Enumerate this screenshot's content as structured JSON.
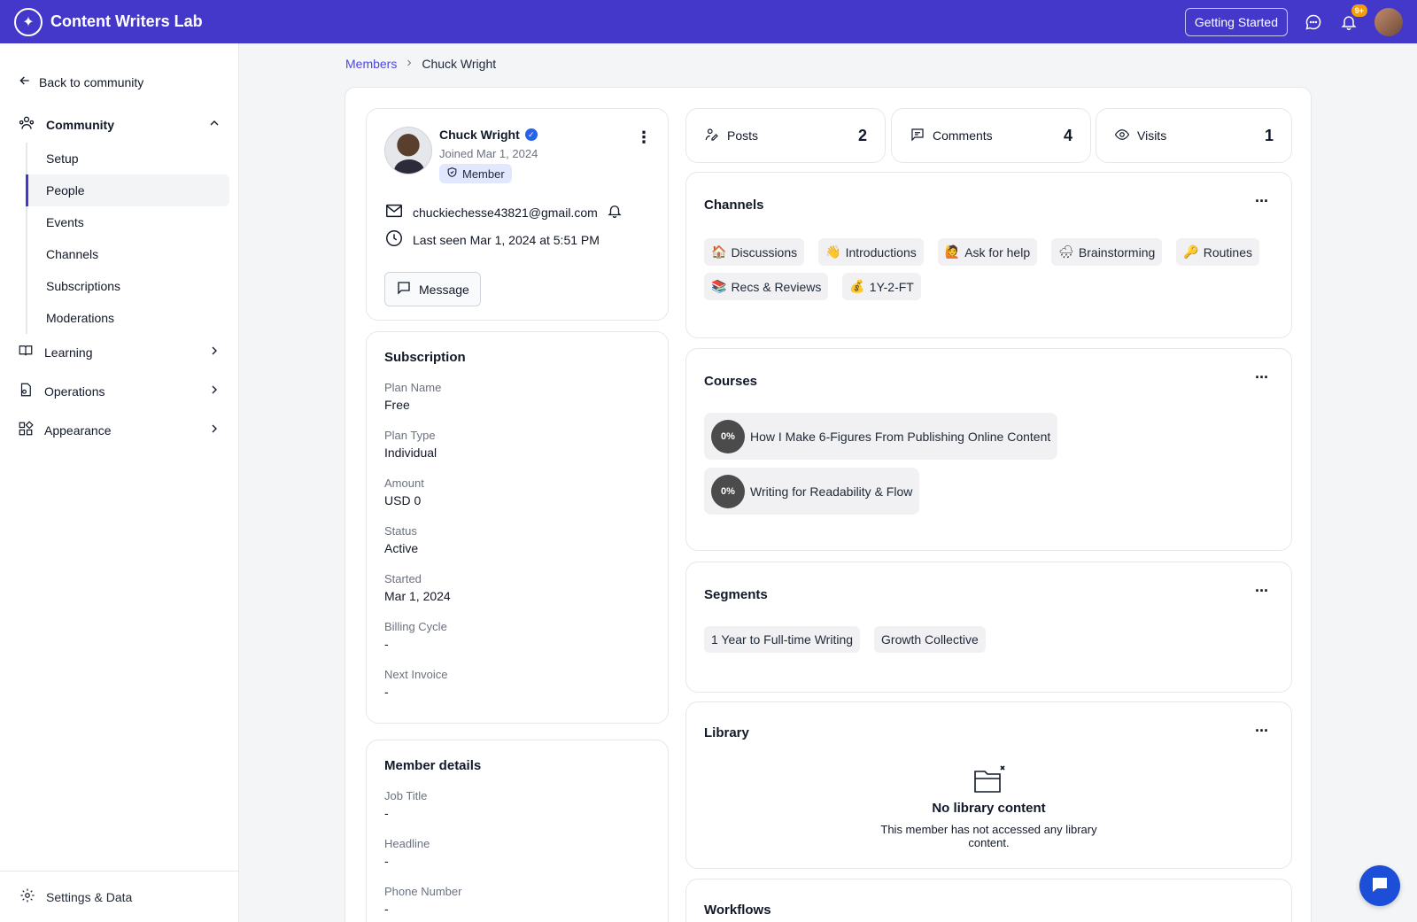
{
  "app": {
    "name": "Content Writers Lab",
    "getting_started": "Getting Started",
    "notif_count": "9+",
    "accent": "#4338ca"
  },
  "sidebar": {
    "back": "Back to community",
    "community": "Community",
    "sub_items": [
      "Setup",
      "People",
      "Events",
      "Channels",
      "Subscriptions",
      "Moderations"
    ],
    "learning": "Learning",
    "operations": "Operations",
    "appearance": "Appearance",
    "footer": "Settings & Data"
  },
  "breadcrumb": {
    "parent": "Members",
    "current": "Chuck Wright"
  },
  "profile": {
    "name": "Chuck Wright",
    "joined": "Joined Mar 1, 2024",
    "role": "Member",
    "email": "chuckiechesse43821@gmail.com",
    "last_seen": "Last seen Mar 1, 2024 at 5:51 PM",
    "message_label": "Message"
  },
  "subscription": {
    "title": "Subscription",
    "fields": [
      {
        "label": "Plan Name",
        "value": "Free"
      },
      {
        "label": "Plan Type",
        "value": "Individual"
      },
      {
        "label": "Amount",
        "value": "USD 0"
      },
      {
        "label": "Status",
        "value": "Active"
      },
      {
        "label": "Started",
        "value": "Mar 1, 2024"
      },
      {
        "label": "Billing Cycle",
        "value": "-"
      },
      {
        "label": "Next Invoice",
        "value": "-"
      }
    ]
  },
  "member_details": {
    "title": "Member details",
    "fields": [
      {
        "label": "Job Title",
        "value": "-"
      },
      {
        "label": "Headline",
        "value": "-"
      },
      {
        "label": "Phone Number",
        "value": "-"
      }
    ]
  },
  "stats": {
    "posts_label": "Posts",
    "posts": "2",
    "comments_label": "Comments",
    "comments": "4",
    "visits_label": "Visits",
    "visits": "1"
  },
  "channels": {
    "title": "Channels",
    "items": [
      {
        "emoji": "🏠",
        "label": "Discussions"
      },
      {
        "emoji": "👋",
        "label": "Introductions"
      },
      {
        "emoji": "🙋",
        "label": "Ask for help"
      },
      {
        "emoji": "🌧",
        "label": "Brainstorming"
      },
      {
        "emoji": "🔑",
        "label": "Routines"
      },
      {
        "emoji": "📚",
        "label": "Recs & Reviews"
      },
      {
        "emoji": "💰",
        "label": "1Y-2-FT"
      }
    ]
  },
  "courses": {
    "title": "Courses",
    "items": [
      {
        "progress": "0%",
        "label": "How I Make 6-Figures From Publishing Online Content"
      },
      {
        "progress": "0%",
        "label": "Writing for Readability & Flow"
      }
    ]
  },
  "segments": {
    "title": "Segments",
    "items": [
      "1 Year to Full-time Writing",
      "Growth Collective"
    ]
  },
  "library": {
    "title": "Library",
    "empty_title": "No library content",
    "empty_text_1": "This member has not accessed any library",
    "empty_text_2": "content."
  },
  "workflows": {
    "title": "Workflows"
  }
}
